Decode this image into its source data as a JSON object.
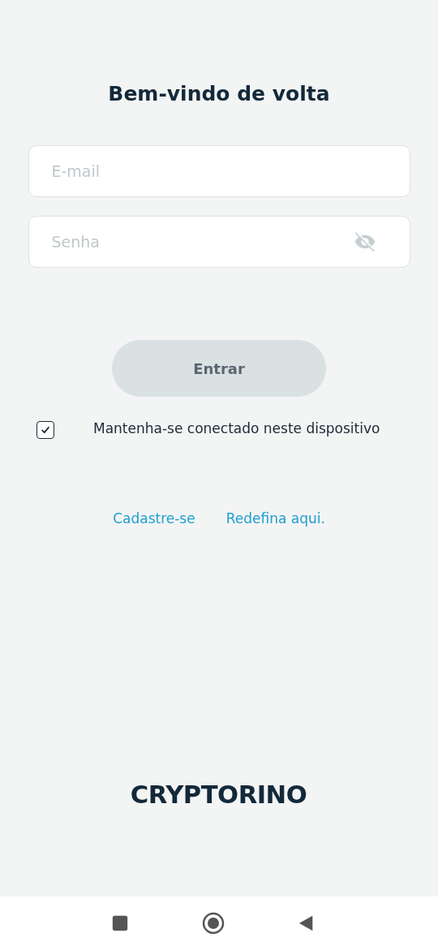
{
  "title": "Bem-vindo de volta",
  "email": {
    "placeholder": "E-mail"
  },
  "password": {
    "placeholder": "Senha",
    "visible": false
  },
  "submit": {
    "label": "Entrar",
    "disabled": true
  },
  "remember": {
    "label": "Mantenha-se conectado neste dispositivo",
    "checked": true
  },
  "links": [
    "Cadastre-se",
    "Redefina aqui."
  ],
  "logo": "CRYPTORINO"
}
